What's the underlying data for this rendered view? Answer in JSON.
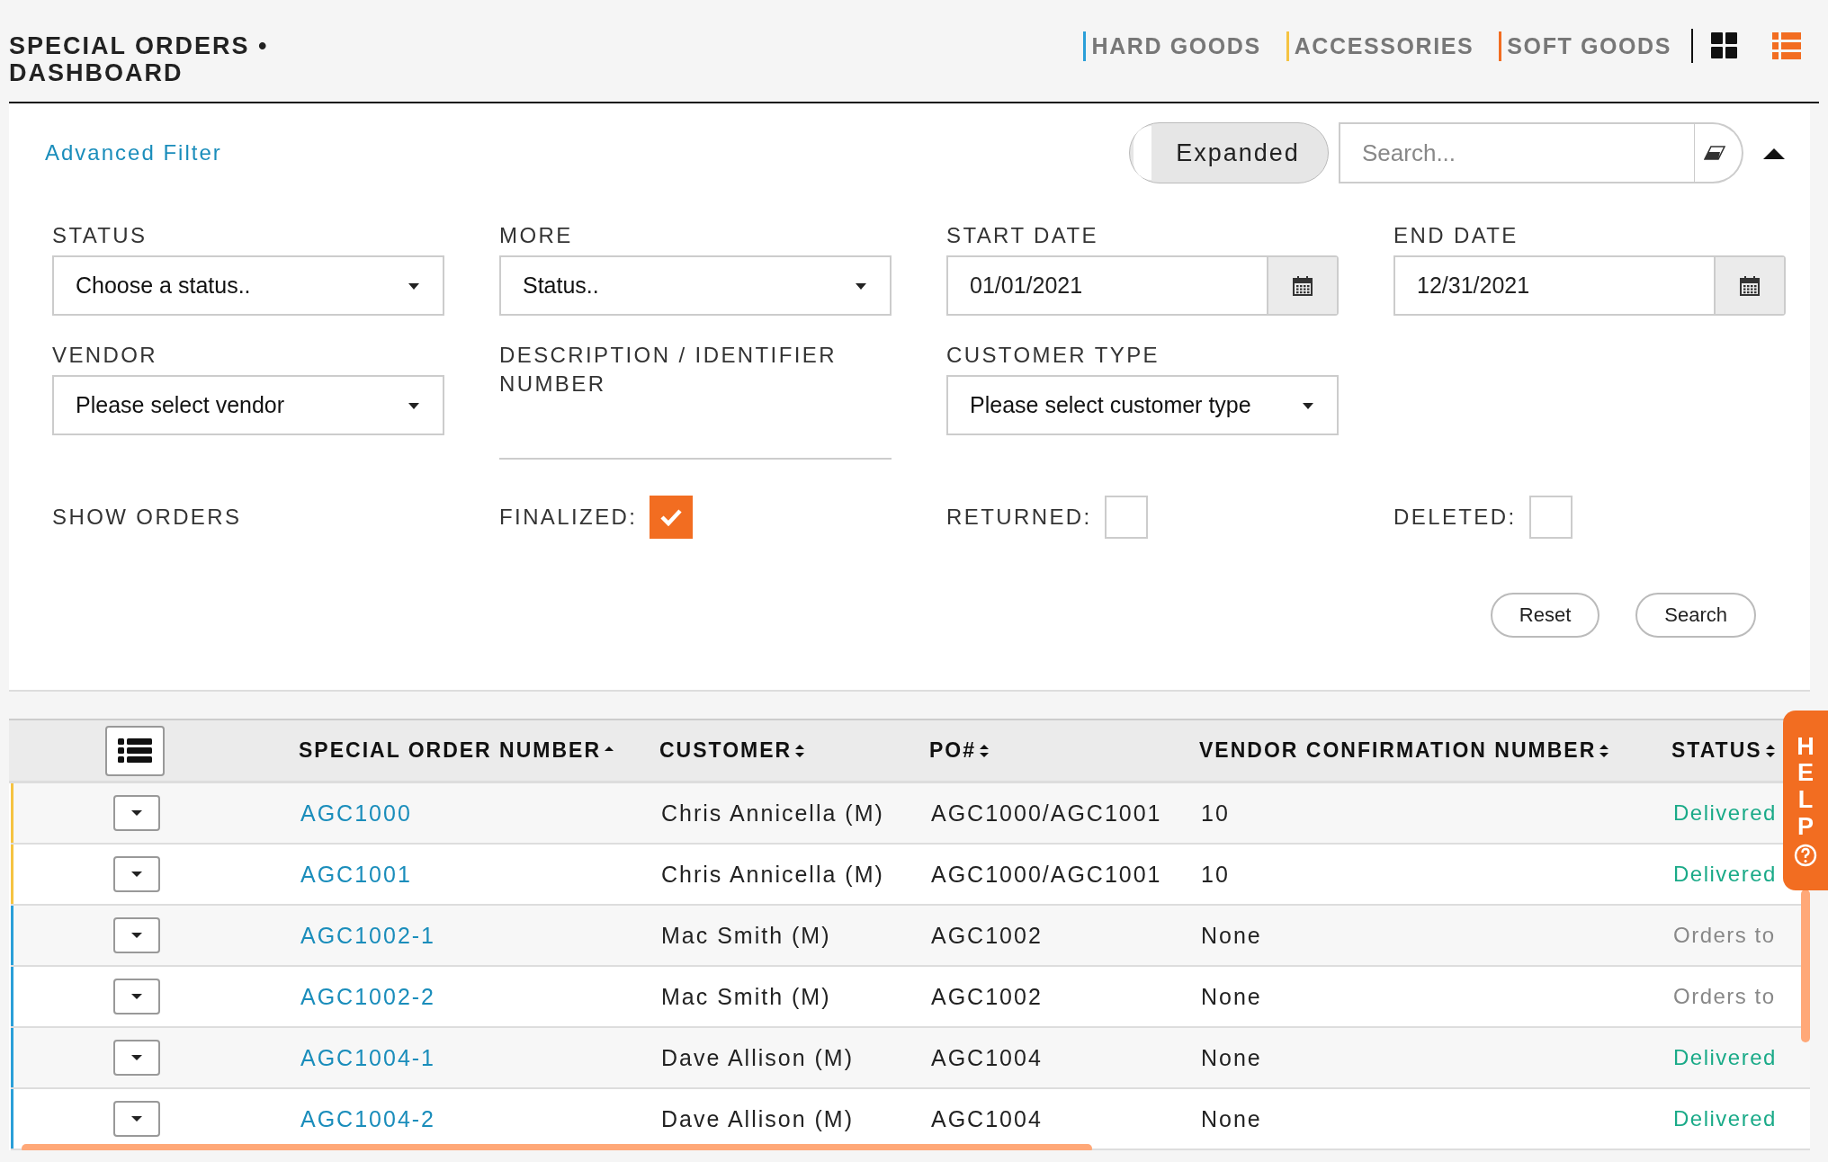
{
  "header": {
    "title": "SPECIAL ORDERS •",
    "subtitle": "DASHBOARD",
    "categories": [
      {
        "label": "HARD GOODS",
        "color": "#2a9fd8"
      },
      {
        "label": "ACCESSORIES",
        "color": "#f5c342"
      },
      {
        "label": "SOFT GOODS",
        "color": "#f26d21"
      }
    ],
    "views": [
      {
        "kind": "grid",
        "selected": false
      },
      {
        "kind": "list",
        "selected": true
      }
    ]
  },
  "filter": {
    "title": "Advanced Filter",
    "toggle": {
      "label": "Expanded",
      "on": true
    },
    "search": {
      "placeholder": "Search..."
    },
    "expanded": true,
    "fields": [
      {
        "kind": "select",
        "label": "STATUS",
        "value": "Choose a status.."
      },
      {
        "kind": "select",
        "label": "MORE",
        "value": "Status.."
      },
      {
        "kind": "date",
        "label": "START DATE",
        "value": "01/01/2021"
      },
      {
        "kind": "date",
        "label": "END DATE",
        "value": "12/31/2021"
      },
      {
        "kind": "select",
        "label": "VENDOR",
        "value": "Please select vendor"
      },
      {
        "kind": "text",
        "label": "DESCRIPTION / IDENTIFIER NUMBER"
      },
      {
        "kind": "select",
        "label": "CUSTOMER TYPE",
        "value": "Please select customer type"
      }
    ],
    "show_orders": {
      "label": "SHOW ORDERS",
      "options": [
        {
          "label": "FINALIZED:",
          "checked": true
        },
        {
          "label": "RETURNED:",
          "checked": false
        },
        {
          "label": "DELETED:",
          "checked": false
        }
      ]
    },
    "buttons": [
      "Reset",
      "Search"
    ]
  },
  "table": {
    "columns": [
      {
        "label": "SPECIAL ORDER NUMBER",
        "sorted": true
      },
      {
        "label": "CUSTOMER",
        "sorted": false
      },
      {
        "label": "PO#",
        "sorted": false
      },
      {
        "label": "VENDOR CONFIRMATION NUMBER",
        "sorted": false
      },
      {
        "label": "STATUS",
        "sorted": false
      }
    ],
    "rows": [
      {
        "color": "#f5c342",
        "order": "AGC1000",
        "customer": "Chris Annicella (M)",
        "po": "AGC1000/AGC1001",
        "vendor_confirmation": "10",
        "status": {
          "text": "Delivered",
          "color": "#1aaa88"
        }
      },
      {
        "color": "#f5c342",
        "order": "AGC1001",
        "customer": "Chris Annicella (M)",
        "po": "AGC1000/AGC1001",
        "vendor_confirmation": "10",
        "status": {
          "text": "Delivered",
          "color": "#1aaa88"
        }
      },
      {
        "color": "#2a9fd8",
        "order": "AGC1002-1",
        "customer": "Mac Smith (M)",
        "po": "AGC1002",
        "vendor_confirmation": "None",
        "status": {
          "text": "Orders to",
          "color": "#888888"
        }
      },
      {
        "color": "#2a9fd8",
        "order": "AGC1002-2",
        "customer": "Mac Smith (M)",
        "po": "AGC1002",
        "vendor_confirmation": "None",
        "status": {
          "text": "Orders to",
          "color": "#888888"
        }
      },
      {
        "color": "#2a9fd8",
        "order": "AGC1004-1",
        "customer": "Dave Allison (M)",
        "po": "AGC1004",
        "vendor_confirmation": "None",
        "status": {
          "text": "Delivered",
          "color": "#1aaa88"
        }
      },
      {
        "color": "#2a9fd8",
        "order": "AGC1004-2",
        "customer": "Dave Allison (M)",
        "po": "AGC1004",
        "vendor_confirmation": "None",
        "status": {
          "text": "Delivered",
          "color": "#1aaa88"
        }
      }
    ]
  },
  "help": {
    "label": "HELP"
  }
}
